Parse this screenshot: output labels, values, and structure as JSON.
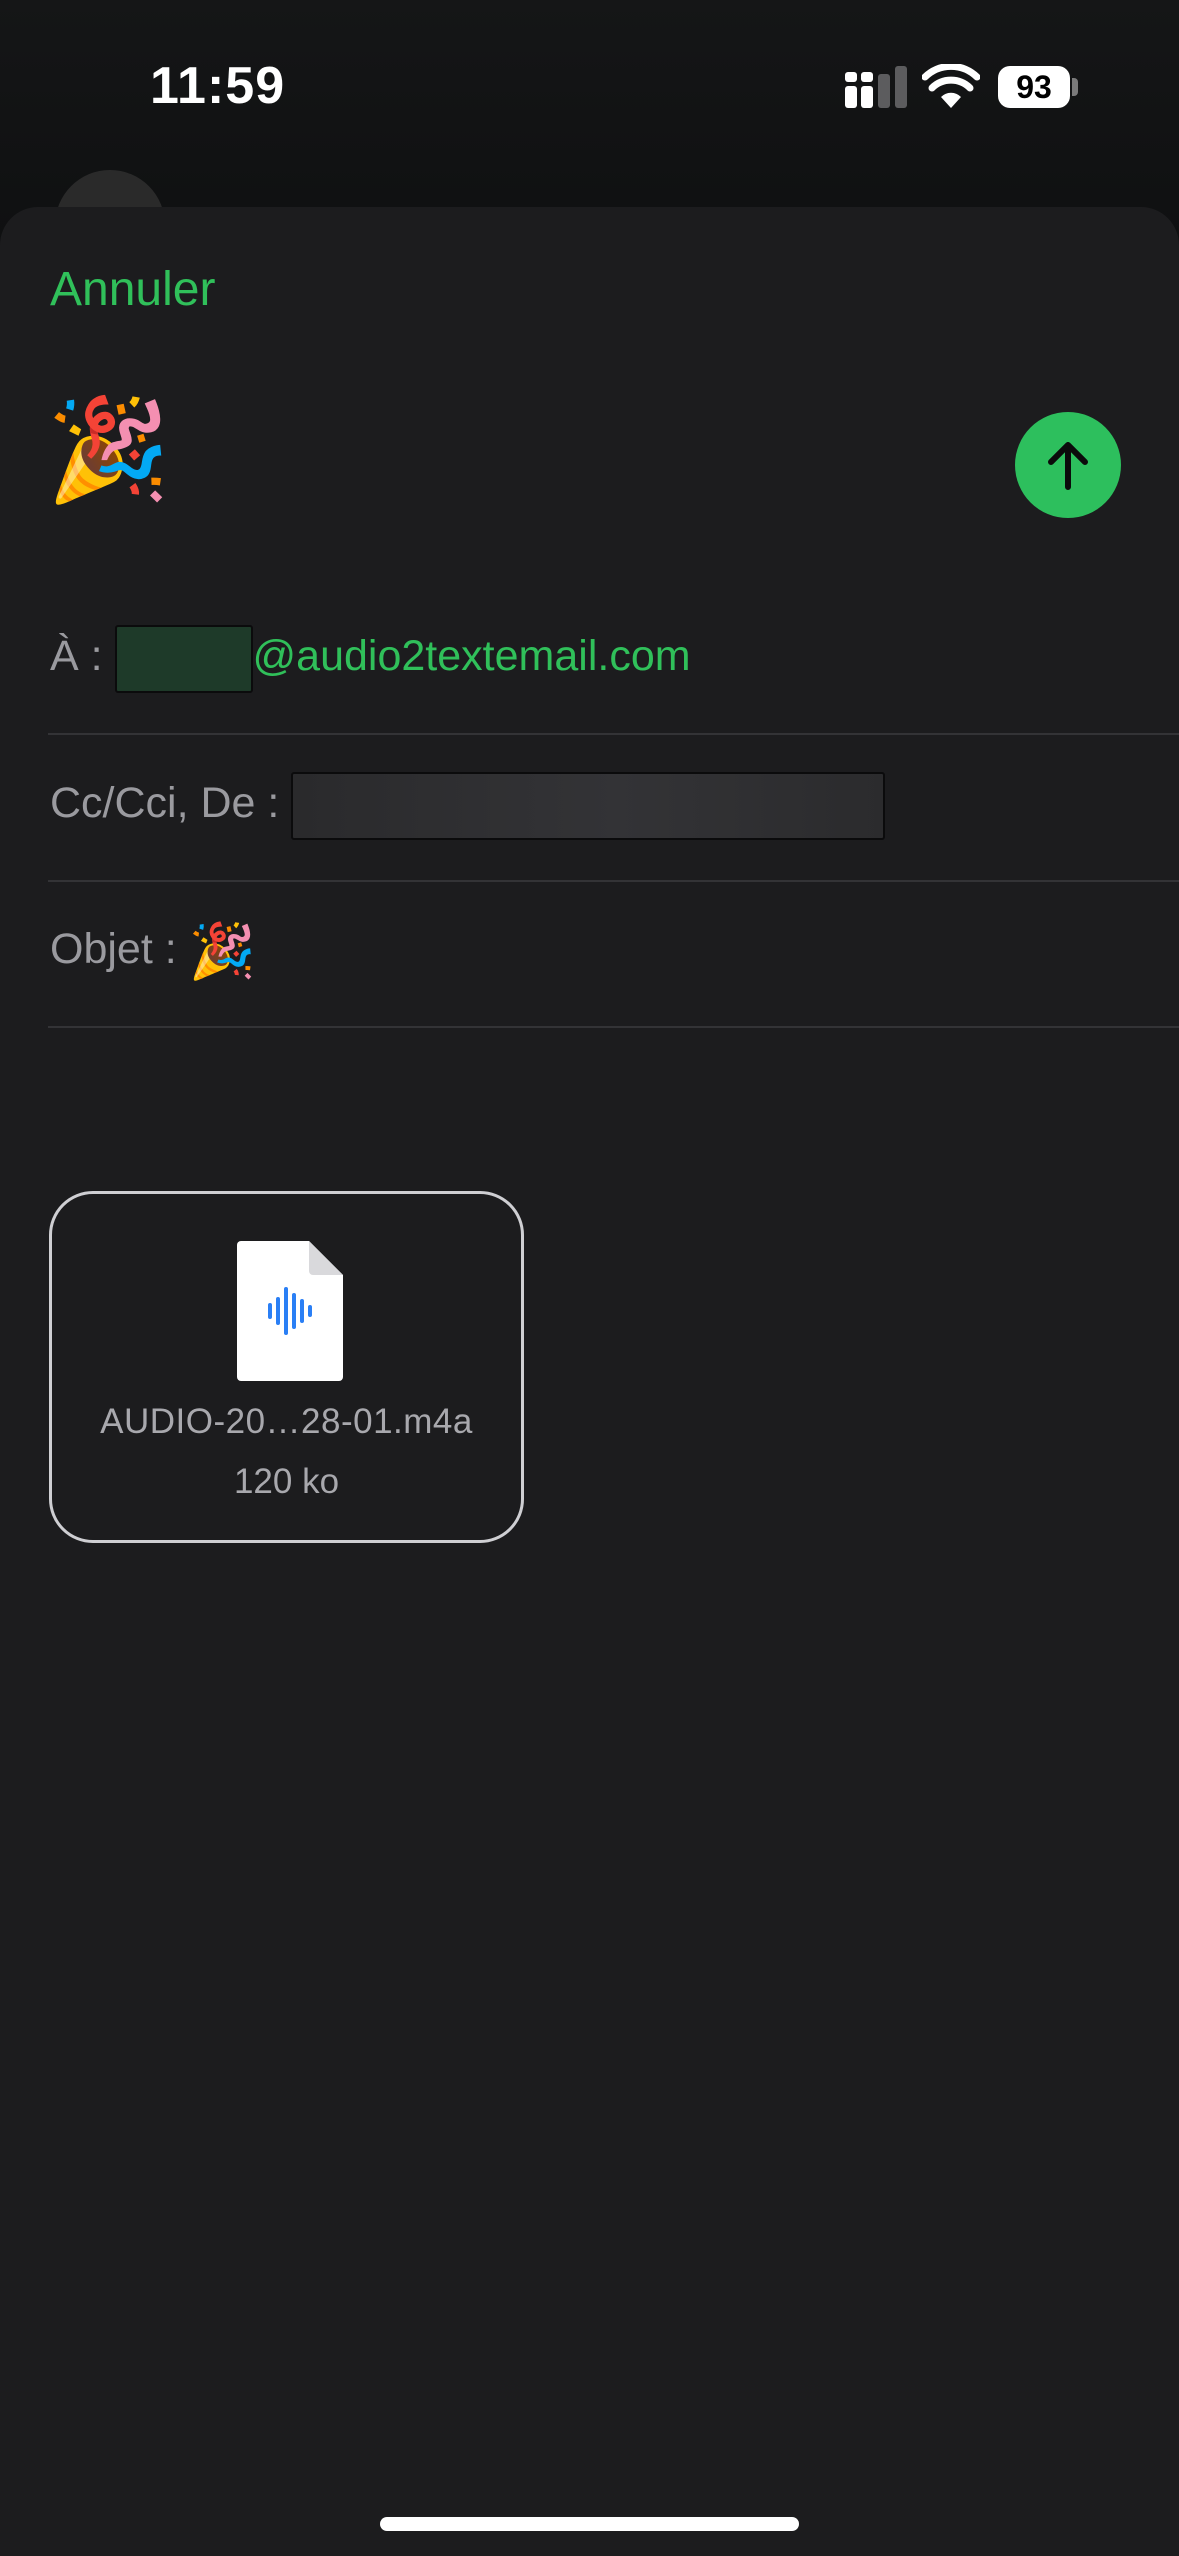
{
  "status_bar": {
    "time": "11:59",
    "battery_level": "93",
    "icons": [
      "signal-icon",
      "wifi-icon",
      "battery-icon"
    ]
  },
  "composer": {
    "cancel_label": "Annuler",
    "subject_emoji": "🎉",
    "send_icon": "arrow-up-icon",
    "to_label": "À :",
    "to_domain": "@audio2textemail.com",
    "cc_label": "Cc/Cci, De :",
    "subject_label": "Objet :",
    "subject_value": "🎉"
  },
  "attachment": {
    "icon": "audio-file-icon",
    "file_name": "AUDIO-20…28-01.m4a",
    "file_size": "120 ko"
  },
  "colors": {
    "accent": "#30c05a",
    "send_button": "#2dbf5d",
    "sheet_background": "#1c1c1e",
    "label_text": "#9a9a9f",
    "audio_wave": "#2a7ff5"
  }
}
